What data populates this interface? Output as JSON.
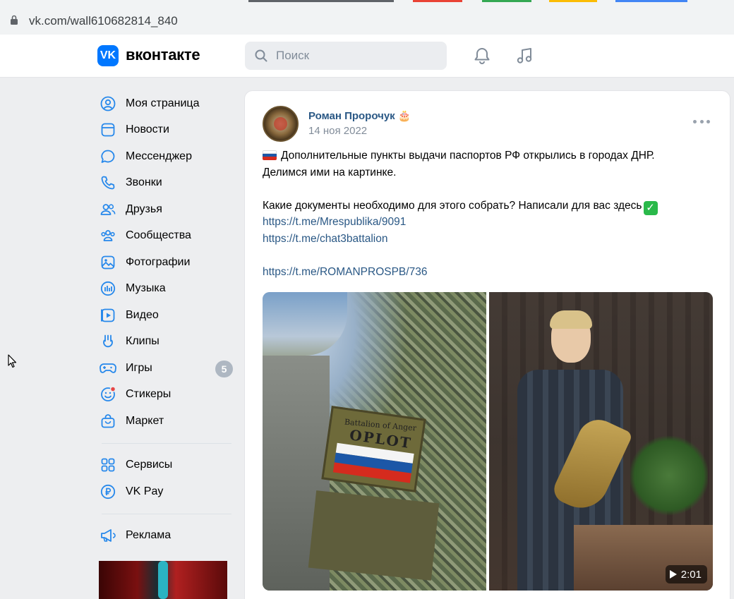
{
  "browser": {
    "url": "vk.com/wall610682814_840"
  },
  "header": {
    "logo_text": "вконтакте",
    "logo_glyph": "VK",
    "search_placeholder": "Поиск",
    "icons": [
      "bell-icon",
      "music-icon"
    ],
    "accent": "#0077ff"
  },
  "sidebar": {
    "items": [
      {
        "label": "Моя страница",
        "icon": "user-circle-icon"
      },
      {
        "label": "Новости",
        "icon": "news-icon"
      },
      {
        "label": "Мессенджер",
        "icon": "message-icon"
      },
      {
        "label": "Звонки",
        "icon": "phone-icon"
      },
      {
        "label": "Друзья",
        "icon": "friends-icon"
      },
      {
        "label": "Сообщества",
        "icon": "communities-icon"
      },
      {
        "label": "Фотографии",
        "icon": "photo-icon"
      },
      {
        "label": "Музыка",
        "icon": "music-bars-icon"
      },
      {
        "label": "Видео",
        "icon": "video-icon"
      },
      {
        "label": "Клипы",
        "icon": "clips-icon"
      },
      {
        "label": "Игры",
        "icon": "games-icon",
        "badge": "5"
      },
      {
        "label": "Стикеры",
        "icon": "sticker-icon"
      },
      {
        "label": "Маркет",
        "icon": "market-icon"
      }
    ],
    "items2": [
      {
        "label": "Сервисы",
        "icon": "services-icon"
      },
      {
        "label": "VK Pay",
        "icon": "vkpay-icon"
      }
    ],
    "items3": [
      {
        "label": "Реклама",
        "icon": "ads-icon"
      }
    ]
  },
  "post": {
    "author": "Роман Пророчук",
    "author_emoji": "🎂",
    "date": "14 ноя 2022",
    "line1": "Дополнительные пункты выдачи паспортов РФ открылись в городах ДНР.",
    "line2": "Делимся ими на картинке.",
    "line3": "Какие документы необходимо для этого собрать? Написали для вас здесь",
    "link1": "https://t.me/Mrespublika/9091",
    "link2": "https://t.me/chat3battalion",
    "link3": "https://t.me/ROMANPROSPB/736",
    "patch_text_top": "Battalion of Anger",
    "patch_text_main": "OPLOT",
    "video_duration": "2:01",
    "link_color": "#2a5885"
  }
}
